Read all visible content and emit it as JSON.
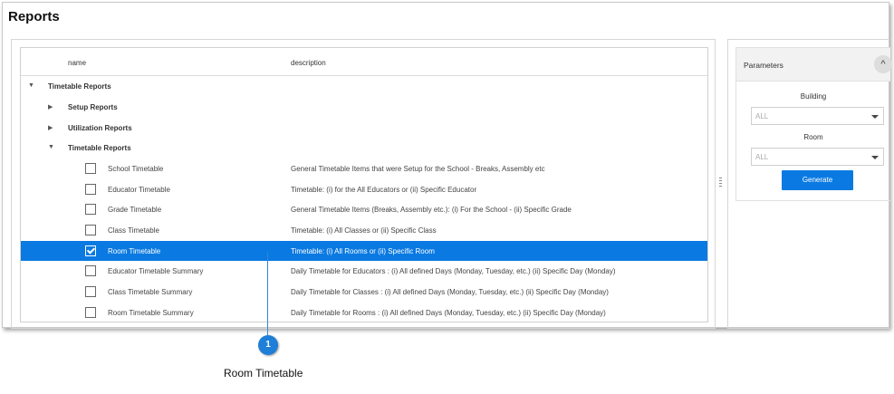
{
  "header": {
    "title": "Reports"
  },
  "grid": {
    "columns": [
      "name",
      "description"
    ],
    "rows": [
      {
        "type": "group",
        "level": 0,
        "expanded": true,
        "name": "Timetable Reports",
        "description": ""
      },
      {
        "type": "group",
        "level": 1,
        "expanded": false,
        "name": "Setup Reports",
        "description": ""
      },
      {
        "type": "group",
        "level": 1,
        "expanded": false,
        "name": "Utilization Reports",
        "description": ""
      },
      {
        "type": "group",
        "level": 1,
        "expanded": true,
        "name": "Timetable Reports",
        "description": ""
      },
      {
        "type": "item",
        "checked": false,
        "selected": false,
        "name": "School Timetable",
        "description": "General Timetable Items that were Setup for the School - Breaks, Assembly etc"
      },
      {
        "type": "item",
        "checked": false,
        "selected": false,
        "name": "Educator Timetable",
        "description": "Timetable: (i) for the All Educators or (ii) Specific Educator"
      },
      {
        "type": "item",
        "checked": false,
        "selected": false,
        "name": "Grade Timetable",
        "description": "General Timetable Items (Breaks, Assembly etc.): (i) For the School - (ii) Specific Grade"
      },
      {
        "type": "item",
        "checked": false,
        "selected": false,
        "name": "Class Timetable",
        "description": "Timetable: (i) All Classes or (ii) Specific Class"
      },
      {
        "type": "item",
        "checked": true,
        "selected": true,
        "name": "Room Timetable",
        "description": "Timetable: (i) All Rooms or (ii) Specific Room"
      },
      {
        "type": "item",
        "checked": false,
        "selected": false,
        "name": "Educator Timetable Summary",
        "description": "Daily Timetable for Educators : (i) All defined Days (Monday, Tuesday, etc.) (ii) Specific Day (Monday)"
      },
      {
        "type": "item",
        "checked": false,
        "selected": false,
        "name": "Class Timetable Summary",
        "description": "Daily Timetable for Classes : (i) All defined Days (Monday, Tuesday, etc.) (ii) Specific Day (Monday)"
      },
      {
        "type": "item",
        "checked": false,
        "selected": false,
        "name": "Room Timetable Summary",
        "description": "Daily Timetable for Rooms : (i) All defined Days (Monday, Tuesday, etc.) (ii) Specific Day (Monday)"
      }
    ]
  },
  "parameters": {
    "title": "Parameters",
    "building_label": "Building",
    "building_value": "ALL",
    "room_label": "Room",
    "room_value": "ALL",
    "generate_label": "Generate"
  },
  "callout": {
    "number": "1",
    "label": "Room Timetable"
  },
  "colors": {
    "selection": "#0a7ae2",
    "callout": "#1f7fd8"
  }
}
